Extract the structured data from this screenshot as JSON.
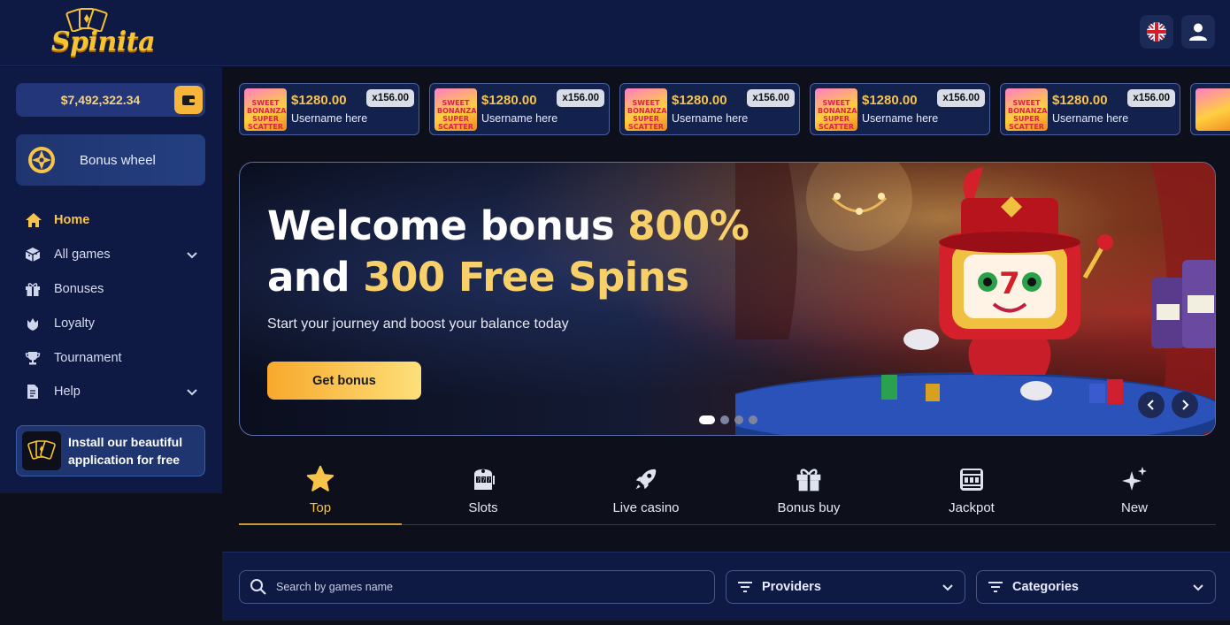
{
  "app": {
    "brand": "Spinita"
  },
  "header": {
    "language_icon": "uk-flag-icon",
    "account_icon": "user-icon"
  },
  "sidebar": {
    "balance": "$7,492,322.34",
    "bonus_wheel": "Bonus wheel",
    "nav": [
      {
        "label": "Home",
        "icon": "home-icon",
        "active": true
      },
      {
        "label": "All games",
        "icon": "cube-icon",
        "expandable": true
      },
      {
        "label": "Bonuses",
        "icon": "gift-icon"
      },
      {
        "label": "Loyalty",
        "icon": "crown-shield-icon"
      },
      {
        "label": "Tournament",
        "icon": "trophy-icon"
      },
      {
        "label": "Help",
        "icon": "document-icon",
        "expandable": true
      }
    ],
    "install": "Install our beautiful application for free"
  },
  "ticker": {
    "items": [
      {
        "amount": "$1280.00",
        "user": "Username here",
        "multiplier": "x156.00",
        "thumb": "SWEET BONANZA SUPER SCATTER"
      },
      {
        "amount": "$1280.00",
        "user": "Username here",
        "multiplier": "x156.00",
        "thumb": "SWEET BONANZA SUPER SCATTER"
      },
      {
        "amount": "$1280.00",
        "user": "Username here",
        "multiplier": "x156.00",
        "thumb": "SWEET BONANZA SUPER SCATTER"
      },
      {
        "amount": "$1280.00",
        "user": "Username here",
        "multiplier": "x156.00",
        "thumb": "SWEET BONANZA SUPER SCATTER"
      },
      {
        "amount": "$1280.00",
        "user": "Username here",
        "multiplier": "x156.00",
        "thumb": "SWEET BONANZA SUPER SCATTER"
      }
    ]
  },
  "hero": {
    "title_line1_a": "Welcome bonus ",
    "title_line1_b": "800%",
    "title_line2_a": "and ",
    "title_line2_b": "300 Free Spins",
    "subtitle": "Start your journey and boost your balance today",
    "cta": "Get bonus",
    "slides": 4,
    "active_slide": 1
  },
  "categories": [
    {
      "label": "Top",
      "icon": "star-icon",
      "active": true
    },
    {
      "label": "Slots",
      "icon": "slot-machine-icon"
    },
    {
      "label": "Live casino",
      "icon": "rocket-icon"
    },
    {
      "label": "Bonus buy",
      "icon": "gift-icon"
    },
    {
      "label": "Jackpot",
      "icon": "jackpot-icon"
    },
    {
      "label": "New",
      "icon": "sparkles-icon"
    }
  ],
  "filters": {
    "search_placeholder": "Search by games name",
    "providers": "Providers",
    "categories": "Categories"
  },
  "colors": {
    "accent": "#f7c34a",
    "panel": "#0f1a44",
    "background": "#0d0f1a"
  }
}
